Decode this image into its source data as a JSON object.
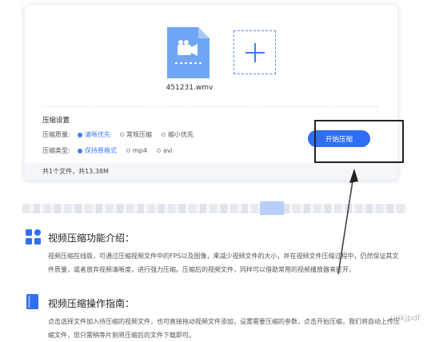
{
  "file": {
    "name": "451231.wmv",
    "icon": "video-file-icon"
  },
  "add_icon": "plus-icon",
  "settings": {
    "title": "压缩设置",
    "quality": {
      "label": "压缩质量:",
      "options": [
        "清晰优先",
        "常规压缩",
        "缩小优先"
      ],
      "selected": "清晰优先"
    },
    "type": {
      "label": "压缩类型:",
      "options": [
        "保持原格式",
        "mp4",
        "avi"
      ],
      "selected": "保持原格式"
    }
  },
  "summary": "共1个文件，共13.38M",
  "start_button": "开始压缩",
  "intro": {
    "title": "视频压缩功能介绍：",
    "text": "视频压缩在线版，可通过压缩视频文件中的FPS以及图像，来减少视频文件的大小，并在视频文件压缩过程中，仍然保证其文件质量，或者放弃视频清晰度，进行强力压缩。压缩后的视频文件，同样可以借助常用的视频播放器来打开。"
  },
  "guide": {
    "title": "视频压缩操作指南：",
    "text": "点击选择文件加入待压缩的视频文件，也可直接拖动视频文件添加，设置需要压缩的参数，点击开始压缩，我们将自动上传压缩文件，您只需稍等片刻将压缩后的文件下载即可。"
  },
  "watermark": "unkjpdf",
  "colors": {
    "accent": "#2f6ff4",
    "file_icon_bg": "#6ea6f5"
  }
}
